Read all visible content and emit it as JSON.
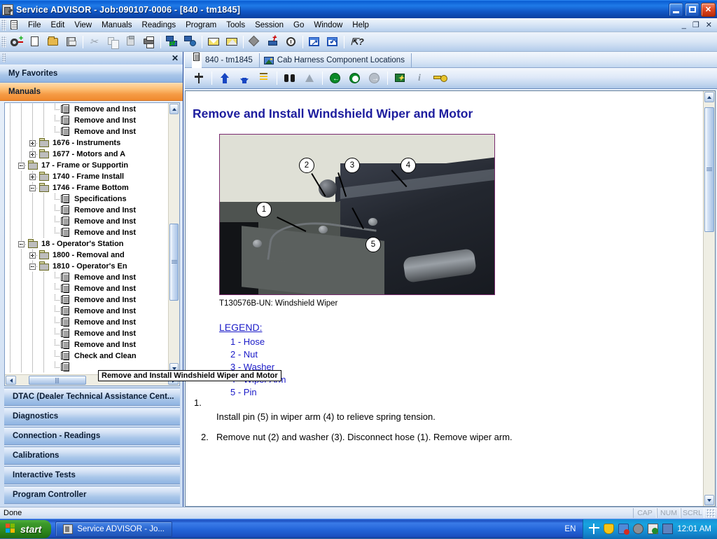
{
  "window": {
    "title": "Service ADVISOR - Job:090107-0006 - [840 - tm1845]",
    "app_icon": "service-advisor-icon",
    "minimize": "_",
    "maximize": "□",
    "close": "✕",
    "mdi_minimize": "_",
    "mdi_restore": "❐",
    "mdi_close": "✕"
  },
  "menu": {
    "items": [
      "File",
      "Edit",
      "View",
      "Manuals",
      "Readings",
      "Program",
      "Tools",
      "Session",
      "Go",
      "Window",
      "Help"
    ]
  },
  "toolbar": {
    "buttons": [
      {
        "name": "options-gear-icon"
      },
      {
        "name": "new-document-icon"
      },
      {
        "name": "open-folder-icon"
      },
      {
        "name": "save-disk-icon"
      },
      {
        "name": "cut-scissors-icon"
      },
      {
        "name": "copy-icon"
      },
      {
        "name": "paste-clipboard-icon"
      },
      {
        "name": "print-icon"
      },
      {
        "name": "connect-computer-icon"
      },
      {
        "name": "disconnect-computer-icon"
      },
      {
        "name": "mail-closed-icon"
      },
      {
        "name": "mail-open-icon"
      },
      {
        "name": "diamond-icon"
      },
      {
        "name": "calibration-icon"
      },
      {
        "name": "alarm-clock-icon"
      },
      {
        "name": "window-restore-icon"
      },
      {
        "name": "window-back-icon"
      },
      {
        "name": "help-pointer-icon"
      }
    ]
  },
  "sidebar": {
    "close_label": "✕",
    "favorites_bar": "My Favorites",
    "manuals_bar": "Manuals",
    "tree": [
      {
        "label": "Remove and Inst",
        "type": "doc",
        "indent": 5
      },
      {
        "label": "Remove and Inst",
        "type": "doc",
        "indent": 5
      },
      {
        "label": "Remove and Inst",
        "type": "doc",
        "indent": 5
      },
      {
        "label": "1676 - Instruments",
        "type": "folder",
        "indent": 3,
        "expander": "plus"
      },
      {
        "label": "1677 - Motors and A",
        "type": "folder",
        "indent": 3,
        "expander": "plus"
      },
      {
        "label": "17 - Frame or Supportin",
        "type": "folder",
        "indent": 2,
        "expander": "minus"
      },
      {
        "label": "1740 - Frame Install",
        "type": "folder",
        "indent": 3,
        "expander": "plus"
      },
      {
        "label": "1746 - Frame Bottom",
        "type": "folder",
        "indent": 3,
        "expander": "minus"
      },
      {
        "label": "Specifications",
        "type": "doc",
        "indent": 5
      },
      {
        "label": "Remove and Inst",
        "type": "doc",
        "indent": 5
      },
      {
        "label": "Remove and Inst",
        "type": "doc",
        "indent": 5
      },
      {
        "label": "Remove and Inst",
        "type": "doc",
        "indent": 5
      },
      {
        "label": "18 - Operator's Station",
        "type": "folder",
        "indent": 2,
        "expander": "minus"
      },
      {
        "label": "1800 - Removal and",
        "type": "folder",
        "indent": 3,
        "expander": "plus"
      },
      {
        "label": "1810 - Operator's En",
        "type": "folder",
        "indent": 3,
        "expander": "minus"
      },
      {
        "label": "Remove and Inst",
        "type": "doc",
        "indent": 5
      },
      {
        "label": "Remove and Inst",
        "type": "doc",
        "indent": 5
      },
      {
        "label": "Remove and Inst",
        "type": "doc",
        "indent": 5
      },
      {
        "label": "Remove and Inst",
        "type": "doc",
        "indent": 5
      },
      {
        "label": "Remove and Inst",
        "type": "doc",
        "indent": 5
      },
      {
        "label": "Remove and Inst",
        "type": "doc",
        "indent": 5
      },
      {
        "label": "Remove and Inst",
        "type": "doc",
        "indent": 5
      },
      {
        "label": "Check and Clean",
        "type": "doc",
        "indent": 5
      },
      {
        "label": "",
        "type": "doc",
        "indent": 5
      }
    ],
    "tooltip": "Remove and Install Windshield Wiper and Motor",
    "panels": [
      "DTAC (Dealer Technical Assistance Cent...",
      "Diagnostics",
      "Connection - Readings",
      "Calibrations",
      "Interactive Tests",
      "Program Controller"
    ]
  },
  "tabs": [
    {
      "label": "840 - tm1845",
      "icon": "document-icon"
    },
    {
      "label": "Cab Harness Component Locations",
      "icon": "picture-icon"
    }
  ],
  "doc_toolbar": {
    "buttons": [
      {
        "name": "pin-icon"
      },
      {
        "name": "previous-up-arrow-icon"
      },
      {
        "name": "next-down-arrow-icon"
      },
      {
        "name": "table-of-contents-icon"
      },
      {
        "name": "find-binoculars-icon"
      },
      {
        "name": "up-triangle-icon"
      },
      {
        "name": "back-arrow-icon"
      },
      {
        "name": "history-clock-icon"
      },
      {
        "name": "forward-arrow-icon"
      },
      {
        "name": "bookmark-add-icon"
      },
      {
        "name": "info-icon"
      },
      {
        "name": "key-icon"
      }
    ]
  },
  "document": {
    "heading": "Remove and Install Windshield Wiper and Motor",
    "figure": {
      "callouts": [
        "1",
        "2",
        "3",
        "4",
        "5"
      ],
      "caption": "T130576B-UN: Windshield Wiper"
    },
    "legend_label": "LEGEND:",
    "legend_items": [
      "1 - Hose",
      "2 - Nut",
      "3 - Washer",
      "4 - Wiper Arm",
      "5 - Pin"
    ],
    "steps": [
      {
        "num": "1.",
        "text": "Install pin (5) in wiper arm (4) to relieve spring tension."
      },
      {
        "num": "2.",
        "text": "Remove nut (2) and washer (3). Disconnect hose (1). Remove wiper arm."
      }
    ]
  },
  "statusbar": {
    "message": "Done",
    "cells": [
      "CAP",
      "NUM",
      "SCRL"
    ]
  },
  "taskbar": {
    "start": "start",
    "items": [
      {
        "label": "Service ADVISOR - Jo...",
        "icon": "service-advisor-icon"
      }
    ],
    "language": "EN",
    "tray_icons": [
      "network-icon",
      "security-shield-icon",
      "network-error-icon",
      "volume-icon",
      "media-icon",
      "display-icon"
    ],
    "clock": "12:01 AM"
  },
  "colors": {
    "title_blue": "#1f7ae8",
    "manuals_orange": "#f59b45",
    "heading_navy": "#1d1d9e",
    "legend_blue": "#1b1bc8",
    "figure_border": "#7a2a6e",
    "taskbar_blue": "#2364d8",
    "start_green": "#2f8a1e"
  }
}
